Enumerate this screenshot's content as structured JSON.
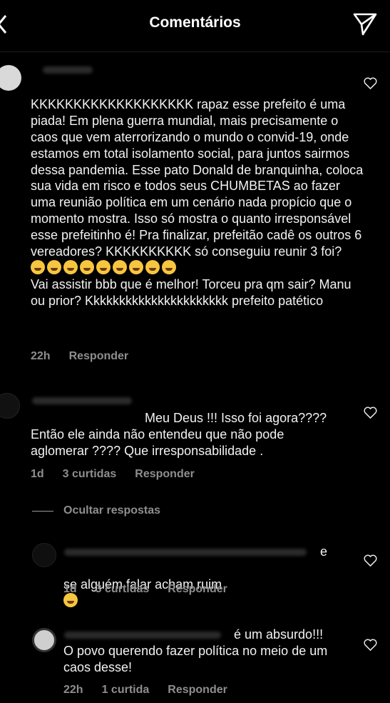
{
  "header": {
    "title": "Comentários"
  },
  "comments": [
    {
      "text": "KKKKKKKKKKKKKKKKKKK rapaz esse prefeito é uma piada! Em plena guerra mundial, mais precisamente o caos que vem aterrorizando o mundo o convid-19, onde estamos em total isolamento social, para juntos sairmos dessa pandemia. Esse pato Donald de branquinha, coloca sua vida em risco e todos seus CHUMBETAS ao fazer uma reunião política em um cenário nada propício que o momento mostra. Isso só mostra o quanto irresponsável esse prefeitinho é! Pra finalizar, prefeitão cadê os outros 6 vereadores? KKKKKKKKKK só conseguiu reunir 3 foi?",
      "text_tail": "Vai assistir bbb que é melhor! Torceu pra qm sair? Manu ou prior? Kkkkkkkkkkkkkkkkkkkkkk prefeito patético",
      "time": "22h",
      "reply": "Responder"
    },
    {
      "text": "Meu Deus !!! Isso foi agora???? Então ele ainda não entendeu que não pode aglomerar ???? Que irresponsabilidade .",
      "time": "1d",
      "likes": "3 curtidas",
      "reply": "Responder"
    }
  ],
  "hide_replies": "Ocultar respostas",
  "replies": [
    {
      "text_a": "e",
      "text_b": "se alguém falar acham ruim",
      "time": "1d",
      "likes": "3 curtidas",
      "reply": "Responder"
    },
    {
      "text_a": "é um absurdo!!!",
      "text_b": "O povo querendo fazer política no meio de um caos desse!",
      "time": "22h",
      "likes": "1 curtida",
      "reply": "Responder"
    }
  ]
}
